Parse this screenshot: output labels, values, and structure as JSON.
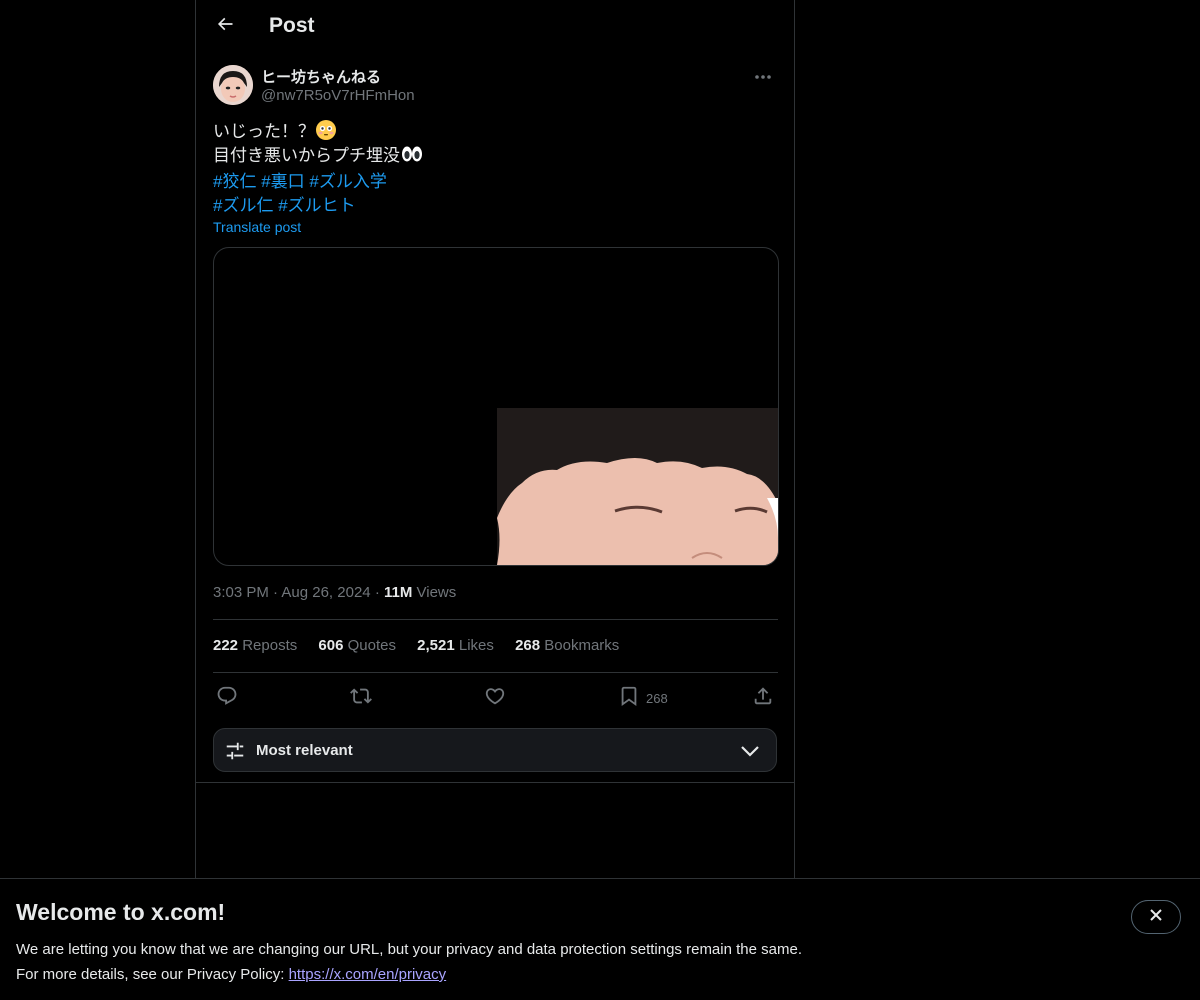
{
  "header": {
    "title": "Post",
    "back_icon": "arrow-left-icon"
  },
  "author": {
    "display_name": "ヒー坊ちゃんねる",
    "handle": "@nw7R5oV7rHFmHon",
    "more_icon": "more-horizontal-icon"
  },
  "post": {
    "line1": "いじった！？",
    "line1_emoji": "flushed-face-emoji",
    "line2": "目付き悪いからプチ埋没",
    "line2_emoji": "eyes-emoji",
    "hashtags_line1": [
      "#狡仁",
      "#裏口",
      "#ズル入学"
    ],
    "hashtags_line2": [
      "#ズル仁",
      "#ズルヒト"
    ],
    "translate_label": "Translate post",
    "link_color": "#1d9bf0"
  },
  "meta": {
    "time": "3:03 PM",
    "sep": "·",
    "date": "Aug 26, 2024",
    "views_count": "11M",
    "views_label": "Views"
  },
  "stats": [
    {
      "count": "222",
      "label": "Reposts"
    },
    {
      "count": "606",
      "label": "Quotes"
    },
    {
      "count": "2,521",
      "label": "Likes"
    },
    {
      "count": "268",
      "label": "Bookmarks"
    }
  ],
  "actions": {
    "reply_icon": "reply-icon",
    "repost_icon": "repost-icon",
    "like_icon": "heart-icon",
    "bookmark_icon": "bookmark-icon",
    "bookmark_count": "268",
    "share_icon": "share-icon"
  },
  "sort": {
    "label": "Most relevant",
    "icon": "sliders-icon",
    "chevron": "chevron-down-icon"
  },
  "banner": {
    "title": "Welcome to x.com!",
    "line1": "We are letting you know that we are changing our URL, but your privacy and data protection settings remain the same.",
    "line2_prefix": "For more details, see our Privacy Policy: ",
    "link_text": "https://x.com/en/privacy",
    "close_icon": "close-icon"
  }
}
